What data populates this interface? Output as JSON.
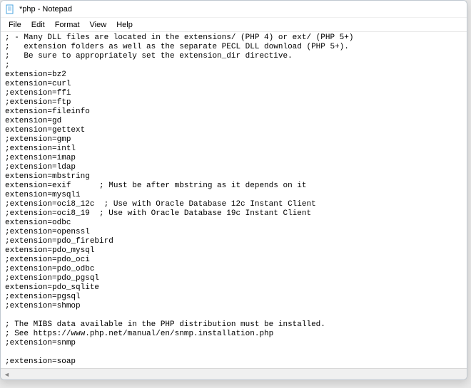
{
  "titlebar": {
    "title": "*php - Notepad"
  },
  "menubar": {
    "items": [
      "File",
      "Edit",
      "Format",
      "View",
      "Help"
    ]
  },
  "editor": {
    "content": "; - Many DLL files are located in the extensions/ (PHP 4) or ext/ (PHP 5+)\n;   extension folders as well as the separate PECL DLL download (PHP 5+).\n;   Be sure to appropriately set the extension_dir directive.\n;\nextension=bz2\nextension=curl\n;extension=ffi\n;extension=ftp\nextension=fileinfo\nextension=gd\nextension=gettext\n;extension=gmp\n;extension=intl\n;extension=imap\n;extension=ldap\nextension=mbstring\nextension=exif      ; Must be after mbstring as it depends on it\nextension=mysqli\n;extension=oci8_12c  ; Use with Oracle Database 12c Instant Client\n;extension=oci8_19  ; Use with Oracle Database 19c Instant Client\nextension=odbc\n;extension=openssl\n;extension=pdo_firebird\nextension=pdo_mysql\n;extension=pdo_oci\n;extension=pdo_odbc\n;extension=pdo_pgsql\nextension=pdo_sqlite\n;extension=pgsql\n;extension=shmop\n\n; The MIBS data available in the PHP distribution must be installed.\n; See https://www.php.net/manual/en/snmp.installation.php\n;extension=snmp\n\n;extension=soap"
  }
}
